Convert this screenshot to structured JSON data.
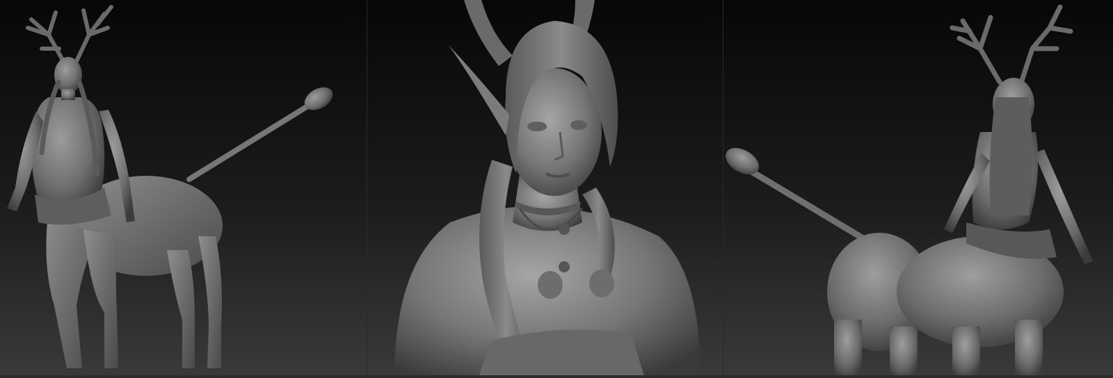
{
  "image": {
    "subject": "",
    "panels": [
      {
        "view": ""
      },
      {
        "view": ""
      },
      {
        "view": ""
      }
    ]
  },
  "colors": {
    "background_top": "#070707",
    "background_bottom": "#3a3a3a",
    "clay": "#6f6f6f",
    "clay_light": "#9a9a9a",
    "clay_dark": "#3f3f3f"
  }
}
